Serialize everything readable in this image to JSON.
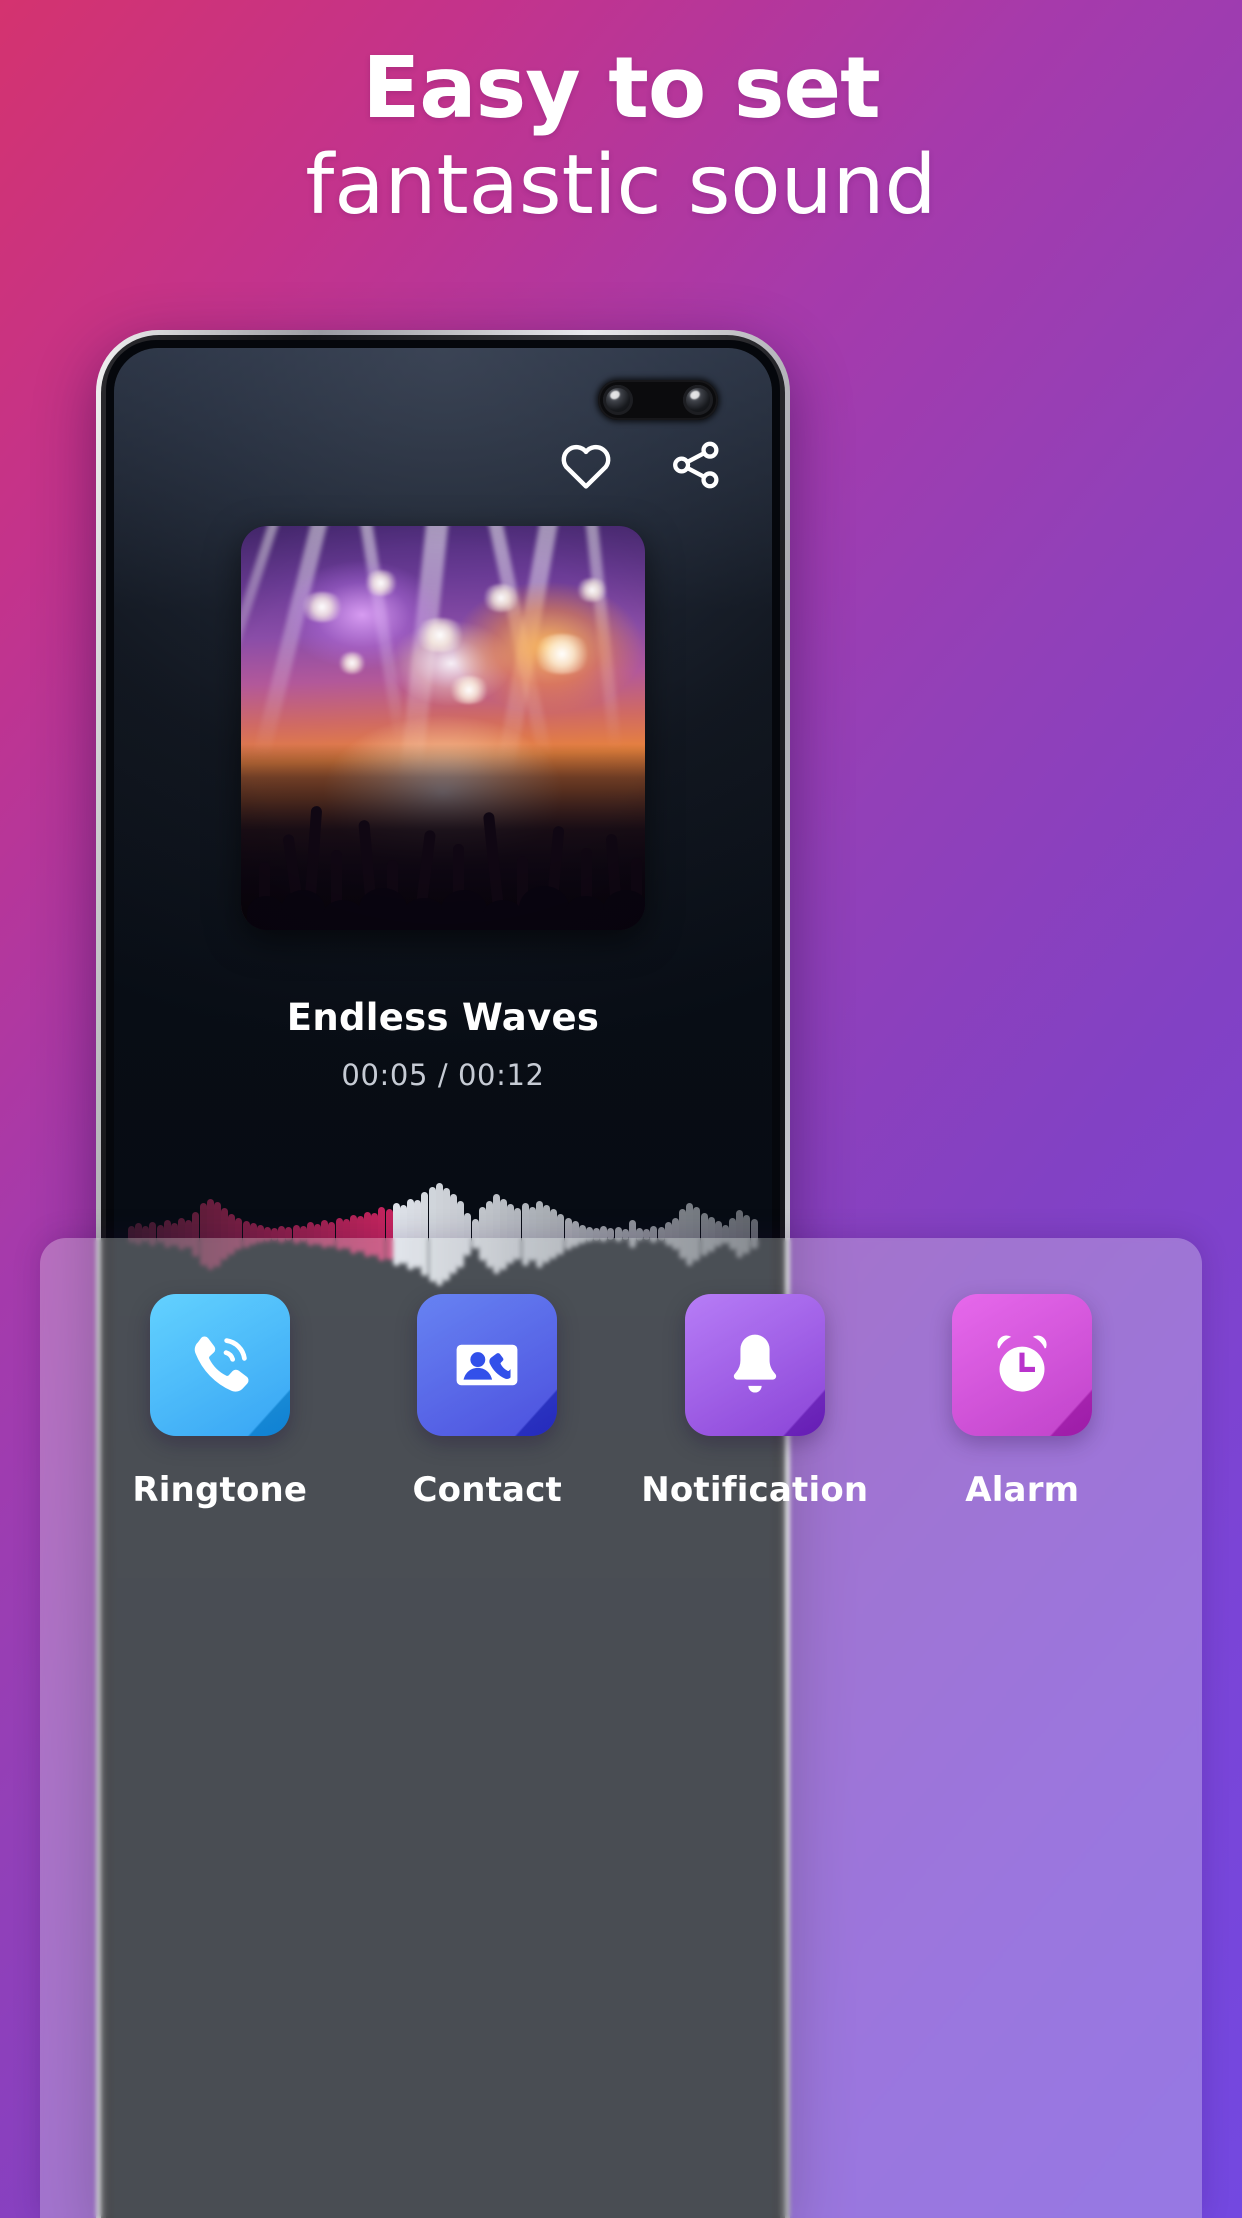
{
  "headline": {
    "line1": "Easy to set",
    "line2": "fantastic sound"
  },
  "background": {
    "gradient_from": "#d4336f",
    "gradient_to": "#7348e0"
  },
  "phone": {
    "camera": {
      "name": "dual-punch-hole-camera",
      "lens_count": 2
    },
    "screen_bg": "#070c14"
  },
  "player": {
    "actions": [
      {
        "id": "favorite",
        "icon": "heart-icon",
        "label": "Favorite"
      },
      {
        "id": "share",
        "icon": "share-icon",
        "label": "Share"
      }
    ],
    "album_art": {
      "name": "concert-crowd-stage-lights",
      "alt": "Concert stage with colorful lights and crowd with raised hands"
    },
    "title": "Endless Waves",
    "current_time": "00:05",
    "total_time": "00:12",
    "time_display": "00:05 / 00:12",
    "progress_percent": 42,
    "waveform": {
      "played_color": "#c4245e",
      "remaining_color": "#e8eaee",
      "bar_count": 88,
      "amplitudes": [
        0.16,
        0.2,
        0.15,
        0.22,
        0.17,
        0.26,
        0.21,
        0.3,
        0.26,
        0.42,
        0.58,
        0.66,
        0.6,
        0.48,
        0.38,
        0.3,
        0.25,
        0.2,
        0.17,
        0.14,
        0.12,
        0.16,
        0.13,
        0.18,
        0.15,
        0.22,
        0.19,
        0.26,
        0.23,
        0.3,
        0.28,
        0.36,
        0.33,
        0.42,
        0.4,
        0.5,
        0.47,
        0.58,
        0.55,
        0.66,
        0.63,
        0.78,
        0.88,
        0.95,
        0.86,
        0.74,
        0.62,
        0.4,
        0.28,
        0.5,
        0.62,
        0.74,
        0.66,
        0.56,
        0.48,
        0.58,
        0.5,
        0.62,
        0.54,
        0.46,
        0.38,
        0.3,
        0.24,
        0.18,
        0.14,
        0.12,
        0.15,
        0.11,
        0.14,
        0.1,
        0.26,
        0.12,
        0.1,
        0.16,
        0.13,
        0.22,
        0.3,
        0.46,
        0.58,
        0.5,
        0.4,
        0.32,
        0.24,
        0.18,
        0.3,
        0.44,
        0.36,
        0.28
      ]
    }
  },
  "actions_panel": {
    "items": [
      {
        "id": "ringtone",
        "label": "Ringtone",
        "icon": "phone-ringing-icon",
        "color_from": "#45c9ff",
        "color_to": "#1193f2"
      },
      {
        "id": "contact",
        "label": "Contact",
        "icon": "contact-card-icon",
        "color_from": "#4a6bf0",
        "color_to": "#2a2fd8"
      },
      {
        "id": "notification",
        "label": "Notification",
        "icon": "bell-icon",
        "color_from": "#a964f5",
        "color_to": "#7420cf"
      },
      {
        "id": "alarm",
        "label": "Alarm",
        "icon": "alarm-clock-icon",
        "color_from": "#e martinez",
        "color_to": "#b41fc0"
      }
    ]
  }
}
